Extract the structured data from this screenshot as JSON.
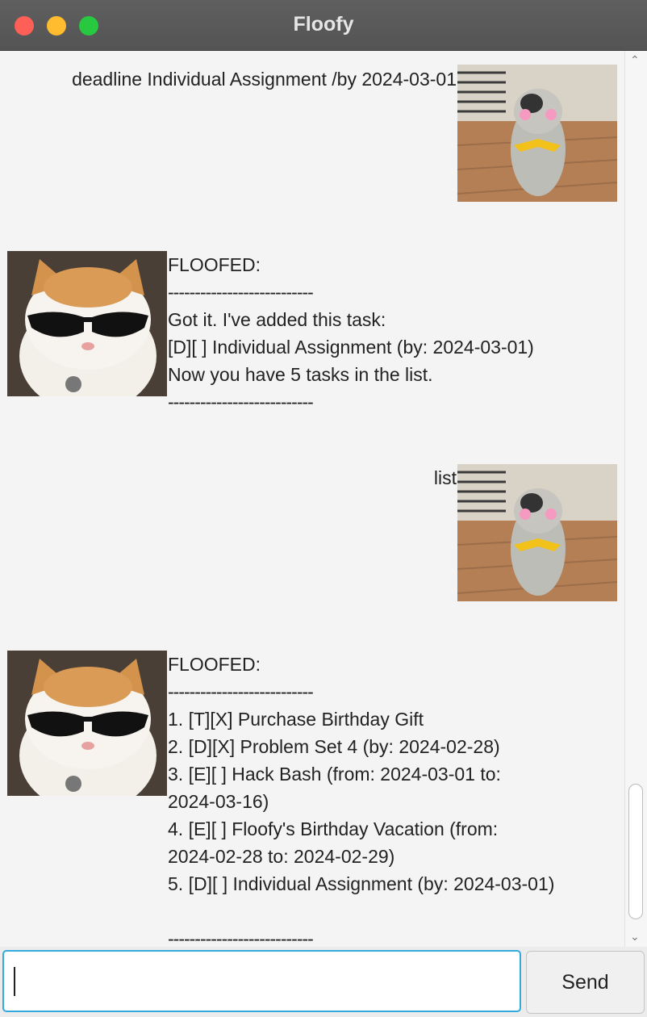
{
  "window": {
    "title": "Floofy"
  },
  "conversation": [
    {
      "sender": "user",
      "text": "deadline Individual Assignment /by 2024-03-01"
    },
    {
      "sender": "bot",
      "lines": [
        "FLOOFED:",
        "---------------------------",
        "Got it. I've added this task:",
        "[D][ ] Individual Assignment (by: 2024-03-01)",
        "Now you have 5 tasks in the list.",
        "---------------------------"
      ]
    },
    {
      "sender": "user",
      "text": "list"
    },
    {
      "sender": "bot",
      "lines": [
        "FLOOFED:",
        "---------------------------",
        "1. [T][X]  Purchase Birthday Gift",
        "2. [D][X] Problem Set 4 (by: 2024-02-28)",
        "3. [E][ ] Hack Bash (from: 2024-03-01 to:",
        "2024-03-16)",
        "4. [E][ ] Floofy's Birthday Vacation (from:",
        "2024-02-28 to: 2024-02-29)",
        "5. [D][ ] Individual Assignment (by: 2024-03-01)",
        "",
        "---------------------------"
      ]
    }
  ],
  "input": {
    "value": "",
    "send_label": "Send"
  },
  "colors": {
    "accent": "#33a9dc",
    "titlebar": "#595959",
    "close": "#fe5f57",
    "minimize": "#febc2e",
    "zoom": "#28c840"
  },
  "avatars": {
    "user": "cat-holding-sign-avatar",
    "bot": "cat-sunglasses-avatar"
  }
}
